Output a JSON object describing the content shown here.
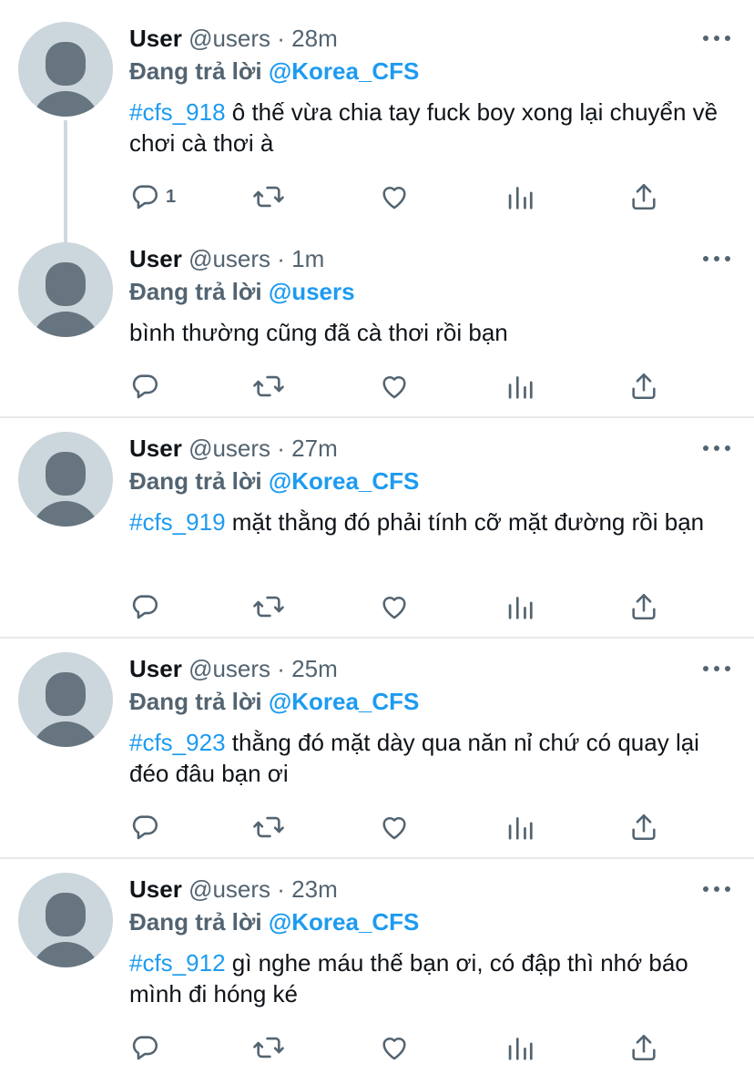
{
  "tweets": [
    {
      "name": "User",
      "handle": "@users",
      "time": "28m",
      "reply_prefix": "Đang trả lời",
      "reply_to": "@Korea_CFS",
      "hashtag": "#cfs_918",
      "body": " ô thế vừa chia tay fuck boy xong lại chuyển về chơi cà thơi à",
      "reply_count": "1"
    },
    {
      "name": "User",
      "handle": "@users",
      "time": "1m",
      "reply_prefix": "Đang trả lời",
      "reply_to": "@users",
      "hashtag": "",
      "body": "bình thường cũng đã cà thơi rồi bạn",
      "reply_count": ""
    },
    {
      "name": "User",
      "handle": "@users",
      "time": "27m",
      "reply_prefix": "Đang trả lời",
      "reply_to": "@Korea_CFS",
      "hashtag": "#cfs_919",
      "body": " mặt thằng đó phải tính cỡ mặt đường rồi bạn",
      "reply_count": ""
    },
    {
      "name": "User",
      "handle": "@users",
      "time": "25m",
      "reply_prefix": "Đang trả lời",
      "reply_to": "@Korea_CFS",
      "hashtag": "#cfs_923",
      "body": " thằng đó mặt dày qua năn nỉ chứ có quay lại đéo đâu bạn ơi",
      "reply_count": ""
    },
    {
      "name": "User",
      "handle": "@users",
      "time": "23m",
      "reply_prefix": "Đang trả lời",
      "reply_to": "@Korea_CFS",
      "hashtag": "#cfs_912",
      "body": " gì nghe máu thế bạn ơi, có đập thì nhớ báo mình đi hóng ké",
      "reply_count": ""
    }
  ],
  "separator": " · ",
  "icons": {
    "reply": "reply-icon",
    "retweet": "retweet-icon",
    "like": "heart-icon",
    "analytics": "analytics-icon",
    "share": "share-icon",
    "more": "more-icon"
  },
  "colors": {
    "link": "#1d9bf0",
    "secondary_text": "#536471",
    "avatar_bg": "#ccd6dd",
    "avatar_fg": "#66757f"
  }
}
